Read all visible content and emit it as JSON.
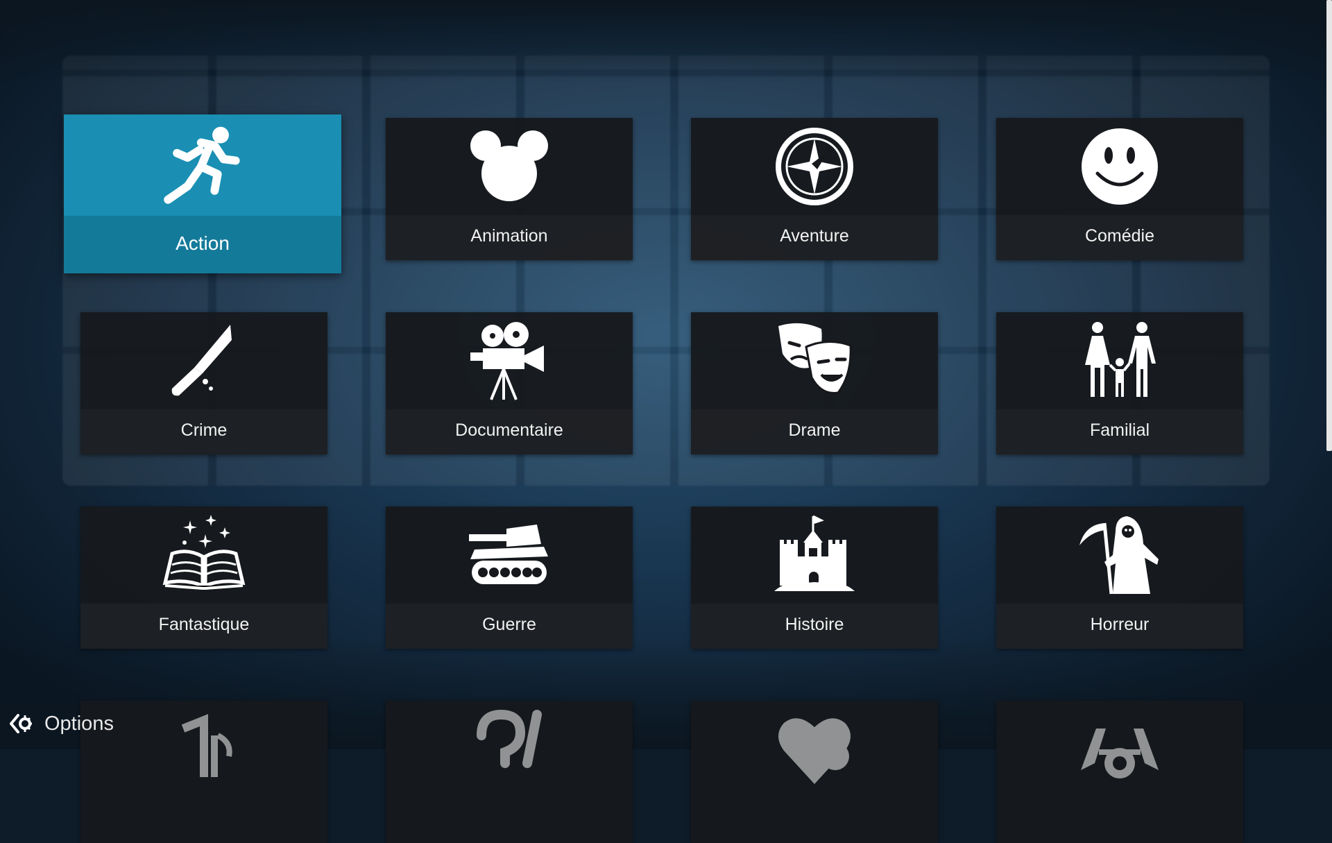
{
  "tiles": [
    {
      "label": "Action",
      "icon": "running-man-icon"
    },
    {
      "label": "Animation",
      "icon": "mouse-ears-icon"
    },
    {
      "label": "Aventure",
      "icon": "compass-icon"
    },
    {
      "label": "Comédie",
      "icon": "smiley-icon"
    },
    {
      "label": "Crime",
      "icon": "bloody-knife-icon"
    },
    {
      "label": "Documentaire",
      "icon": "film-camera-icon"
    },
    {
      "label": "Drame",
      "icon": "theater-masks-icon"
    },
    {
      "label": "Familial",
      "icon": "family-icon"
    },
    {
      "label": "Fantastique",
      "icon": "magic-book-icon"
    },
    {
      "label": "Guerre",
      "icon": "tank-icon"
    },
    {
      "label": "Histoire",
      "icon": "castle-icon"
    },
    {
      "label": "Horreur",
      "icon": "grim-reaper-icon"
    },
    {
      "label": "",
      "icon": "music-note-icon"
    },
    {
      "label": "",
      "icon": "question-mark-icon"
    },
    {
      "label": "",
      "icon": "heart-icon"
    },
    {
      "label": "",
      "icon": "tie-fighter-icon"
    }
  ],
  "focused": "Action",
  "options": {
    "label": "Options",
    "icon": "options-icon"
  },
  "colors": {
    "accent": "#1a8fb3",
    "tile": "#16181c",
    "text": "#f2f2f2"
  }
}
